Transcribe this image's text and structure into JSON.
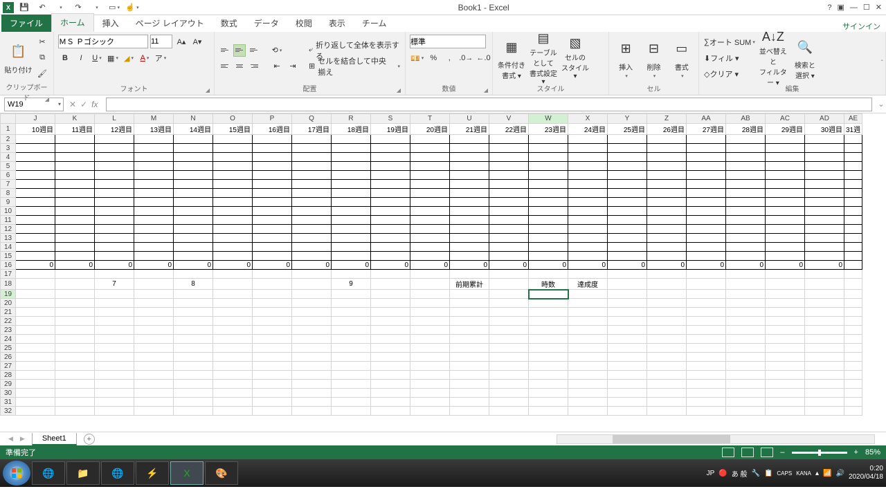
{
  "title": "Book1 - Excel",
  "signin": "サインイン",
  "tabs": {
    "file": "ファイル",
    "home": "ホーム",
    "insert": "挿入",
    "page": "ページ レイアウト",
    "formulas": "数式",
    "data": "データ",
    "review": "校閲",
    "view": "表示",
    "team": "チーム"
  },
  "ribbon": {
    "clipboard": {
      "paste": "貼り付け",
      "label": "クリップボード"
    },
    "font": {
      "name": "ＭＳ Ｐゴシック",
      "size": "11",
      "label": "フォント"
    },
    "align": {
      "wrap": "折り返して全体を表示する",
      "merge": "セルを結合して中央揃え",
      "label": "配置"
    },
    "number": {
      "fmt": "標準",
      "label": "数値"
    },
    "styles": {
      "cond": "条件付き\n書式 ▾",
      "table": "テーブルとして\n書式設定 ▾",
      "cell": "セルの\nスタイル ▾",
      "label": "スタイル"
    },
    "cells": {
      "insert": "挿入",
      "delete": "削除",
      "format": "書式",
      "label": "セル"
    },
    "editing": {
      "sum": "オート SUM",
      "fill": "フィル ▾",
      "clear": "クリア ▾",
      "sort": "並べ替えと\nフィルター ▾",
      "find": "検索と\n選択 ▾",
      "label": "編集"
    }
  },
  "namebox": "W19",
  "columns": [
    "J",
    "K",
    "L",
    "M",
    "N",
    "O",
    "P",
    "Q",
    "R",
    "S",
    "T",
    "U",
    "V",
    "W",
    "X",
    "Y",
    "Z",
    "AA",
    "AB",
    "AC",
    "AD",
    "AE"
  ],
  "row1": [
    "10週目",
    "11週目",
    "12週目",
    "13週目",
    "14週目",
    "15週目",
    "16週目",
    "17週目",
    "18週目",
    "19週目",
    "20週目",
    "21週目",
    "22週目",
    "23週目",
    "24週目",
    "25週目",
    "26週目",
    "27週目",
    "28週目",
    "29週目",
    "30週目",
    "31週"
  ],
  "row16_val": "0",
  "row18": {
    "L": "7",
    "N": "8",
    "R": "9",
    "U": "前期累計",
    "W": "時数",
    "X": "達成度"
  },
  "sheet": "Sheet1",
  "status": "準備完了",
  "zoom": "85%",
  "tray": {
    "lang1": "JP",
    "lang2": "あ 般",
    "caps": "CAPS",
    "kana": "KANA",
    "time": "0:20",
    "date": "2020/04/18"
  }
}
